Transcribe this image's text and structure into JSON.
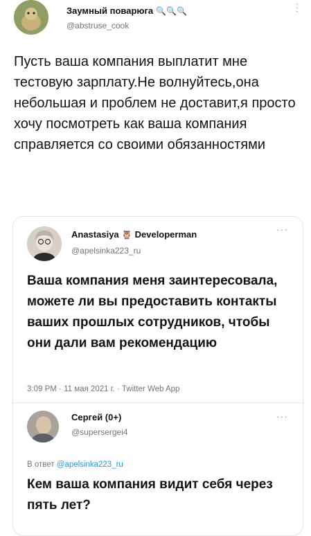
{
  "outer_tweet": {
    "display_name": "Заумный поварюга",
    "name_emoji": "🔍🔍🔍",
    "handle": "@abstruse_cook",
    "more_icon": "ellipsis-vertical-icon",
    "text": "Пусть ваша компания выплатит мне тестовую зарплату.Не волнуйтесь,она небольшая и проблем не доставит,я просто хочу посмотреть как ваша компания справляется со своими обязанностями"
  },
  "quoted_tweet": {
    "display_name": "Anastasiya",
    "emoji": "🦉",
    "name_suffix": "Developerman",
    "handle": "@apelsinka223_ru",
    "text": "Ваша компания меня заинтересовала, можете ли вы предоставить контакты ваших прошлых сотрудников, чтобы они дали вам рекомендацию",
    "time": "3:09 PM",
    "date": "11 мая 2021 г.",
    "source": "Twitter Web App"
  },
  "reply": {
    "display_name": "Сергей (0+)",
    "handle": "@supersergei4",
    "reply_prefix": "В ответ",
    "reply_handle": "@apelsinka223_ru",
    "text": "Кем ваша компания видит себя через пять лет?"
  }
}
